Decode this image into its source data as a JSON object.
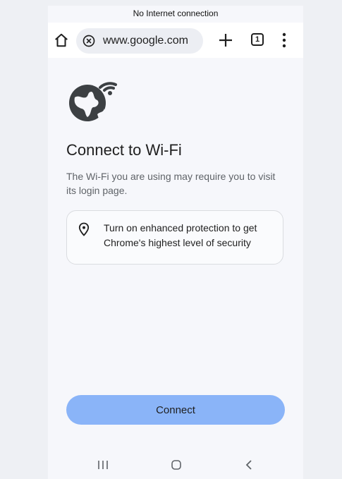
{
  "status_bar": {
    "message": "No Internet connection"
  },
  "toolbar": {
    "url": "www.google.com",
    "tab_count": "1"
  },
  "content": {
    "heading": "Connect to Wi-Fi",
    "description": "The Wi-Fi you are using may require you to visit its login page.",
    "card_text": "Turn on enhanced protection to get Chrome's highest level of security",
    "connect_label": "Connect"
  },
  "colors": {
    "accent": "#8ab4f8",
    "background": "#f6f7fb",
    "text_primary": "#1f1f1f",
    "text_secondary": "#5f6368"
  },
  "icons": {
    "home": "home-icon",
    "security": "not-secure-icon",
    "new_tab": "plus-icon",
    "tabs": "tab-switcher-icon",
    "menu": "more-vert-icon",
    "globe": "globe-wifi-icon",
    "card": "location-pin-icon",
    "nav_recents": "recents-icon",
    "nav_home": "nav-home-icon",
    "nav_back": "back-icon"
  }
}
